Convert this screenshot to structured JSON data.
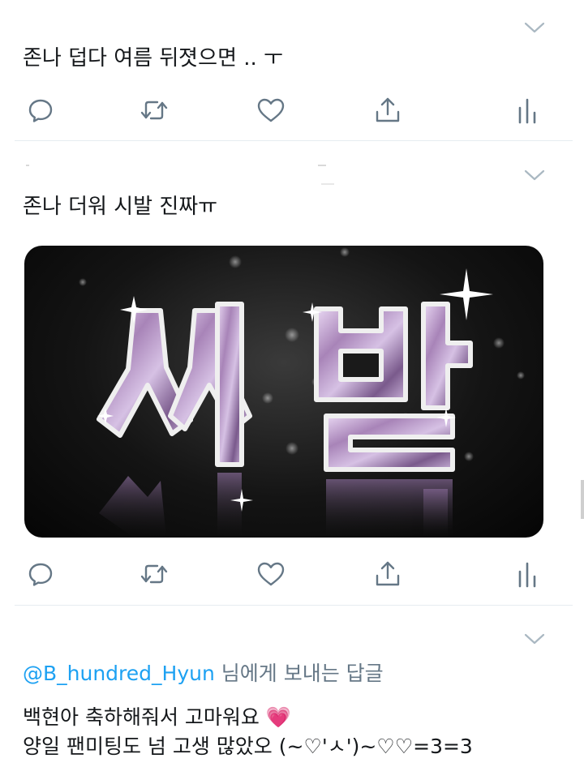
{
  "tweets": [
    {
      "text": "존나 덥다 여름 뒤졋으면 .. ㅜ",
      "actions": [
        "reply-icon",
        "retweet-icon",
        "like-icon",
        "share-icon",
        "analytics-icon"
      ]
    },
    {
      "text": "존나 더워 시발 진짜ㅠ",
      "image": {
        "kind": "sparkling-diamond-text",
        "lettering": "씨발"
      },
      "actions": [
        "reply-icon",
        "retweet-icon",
        "like-icon",
        "share-icon",
        "analytics-icon"
      ]
    },
    {
      "reply_to": {
        "handle": "@B_hundred_Hyun",
        "suffix": " 님에게 보내는 답글"
      },
      "lines": [
        "백현아 축하해줘서 고마워요 💗",
        "양일 팬미팅도 넘 고생 많았오 (~♡'ㅅ')~♡♡=3=3"
      ]
    }
  ],
  "colors": {
    "text": "#14171a",
    "icon": "#657786",
    "link": "#1da1f2",
    "divider": "#e6ecf0",
    "chevron": "#aab8c2"
  }
}
